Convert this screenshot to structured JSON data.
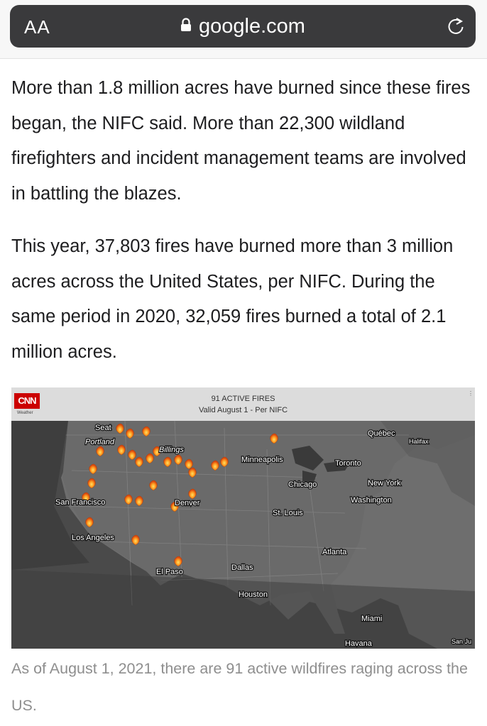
{
  "browser": {
    "aa_label": "AA",
    "url": "google.com"
  },
  "article": {
    "paragraphs": [
      "More than 1.8 million acres have burned since these fires began, the NIFC said. More than 22,300 wildland firefighters and incident management teams are involved in battling the blazes.",
      "This year, 37,803 fires have burned more than 3 million acres across the United States, per NIFC. During the same period in 2020, 32,059 fires burned a total of 2.1 million acres."
    ],
    "figure": {
      "logo": "CNN",
      "logo_sub": "Weather",
      "title": "91 ACTIVE FIRES",
      "subtitle": "Valid August 1 - Per NIFC",
      "cities": [
        "Seat",
        "Portland",
        "Billings",
        "Minneapolis",
        "Québec",
        "Halifax",
        "Toronto",
        "Chicago",
        "New York",
        "San Francisco",
        "Denver",
        "Washington",
        "St. Louis",
        "Los Angeles",
        "Atlanta",
        "El Paso",
        "Dallas",
        "Houston",
        "Miami",
        "Havana",
        "San Ju"
      ],
      "caption": "As of August 1, 2021, there are 91 active wildfires raging across the US."
    }
  }
}
